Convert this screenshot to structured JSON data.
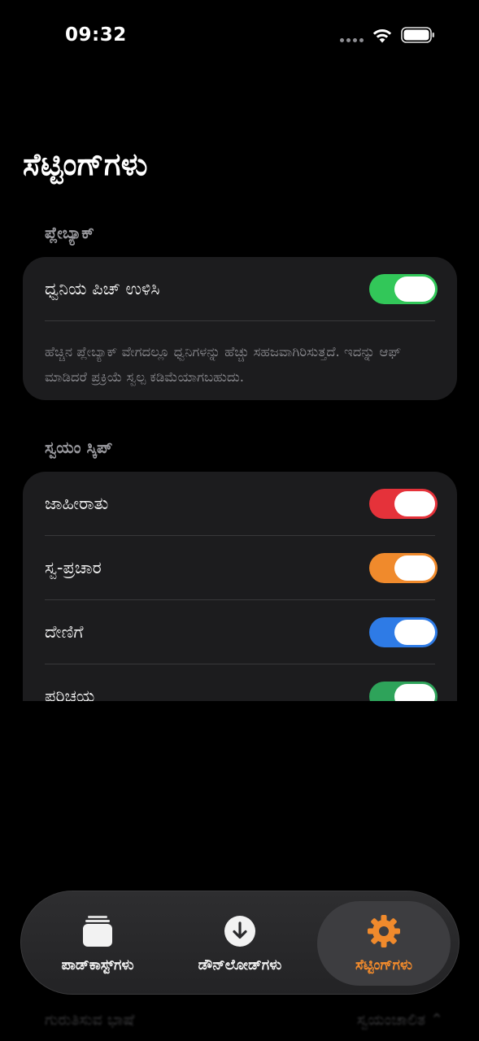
{
  "status": {
    "time": "09:32"
  },
  "title": "ಸೆಟ್ಟಿಂಗ್‌ಗಳು",
  "playback": {
    "header": "ಪ್ಲೇಬ್ಯಾಕ್",
    "pitch_label": "ಧ್ವನಿಯ ಪಿಚ್ ಉಳಿಸಿ",
    "pitch_on": true,
    "description": "ಹೆಚ್ಚಿನ ಪ್ಲೇಬ್ಯಾಕ್ ವೇಗದಲ್ಲೂ ಧ್ವನಿಗಳನ್ನು ಹೆಚ್ಚು ಸಹಜವಾಗಿರಿಸುತ್ತದೆ. ಇದನ್ನು ಆಫ್ ಮಾಡಿದರೆ ಪ್ರಕ್ರಿಯೆ ಸ್ವಲ್ಪ ಕಡಿಮೆಯಾಗಬಹುದು."
  },
  "autoskip": {
    "header": "ಸ್ವಯಂ ಸ್ಕಿಪ್",
    "items": [
      {
        "label": "ಜಾಹೀರಾತು",
        "on": true,
        "color": "#e5323a"
      },
      {
        "label": "ಸ್ವ-ಪ್ರಚಾರ",
        "on": true,
        "color": "#f08a2c"
      },
      {
        "label": "ದೇಣಿಗೆ",
        "on": true,
        "color": "#2e7be6"
      },
      {
        "label": "ಪರಿಚಯ",
        "on": true,
        "color": "#2ea35a"
      }
    ]
  },
  "colors": {
    "green_toggle": "#32c759",
    "accent": "#f08a2c"
  },
  "ghost": {
    "left": "ಗುರುತಿಸುವ ಭಾಷೆ",
    "right": "ಸ್ವಯಂಚಾಲಿತ ⌃"
  },
  "tabs": [
    {
      "label": "ಪಾಡ್‌ಕಾಸ್ಟ್‌ಗಳು",
      "icon": "stack-icon",
      "active": false
    },
    {
      "label": "ಡೌನ್‌ಲೋಡ್‌ಗಳು",
      "icon": "download-icon",
      "active": false
    },
    {
      "label": "ಸೆಟ್ಟಿಂಗ್‌ಗಳು",
      "icon": "gear-icon",
      "active": true
    }
  ]
}
